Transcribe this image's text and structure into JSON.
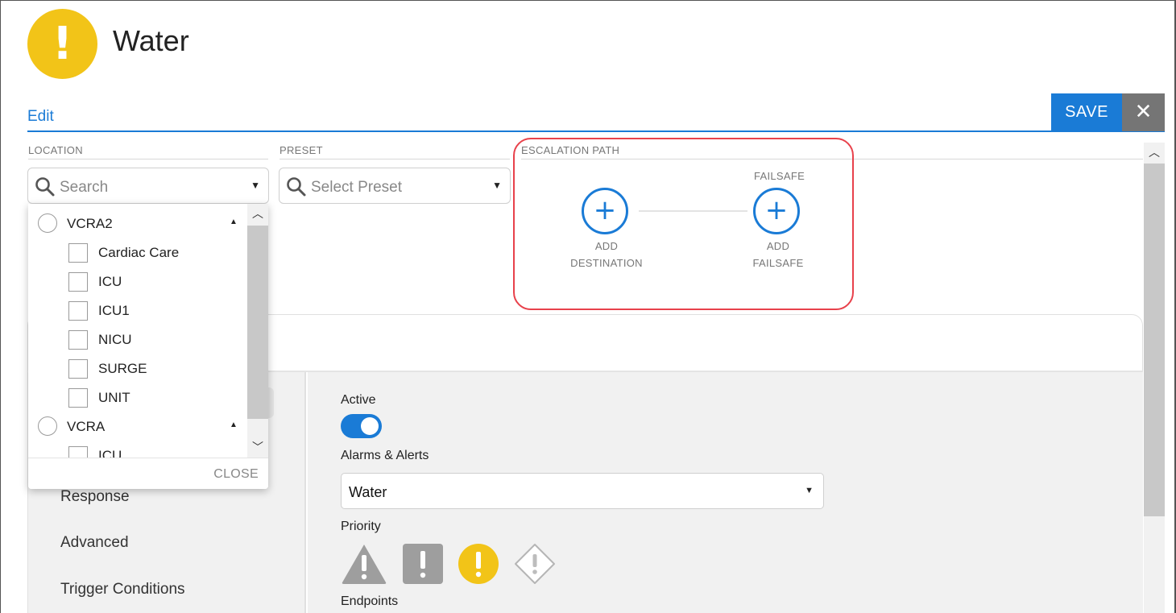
{
  "header": {
    "title": "Water",
    "tab_edit": "Edit",
    "save_label": "SAVE",
    "close_symbol": "✕"
  },
  "location": {
    "label": "LOCATION",
    "placeholder": "Search",
    "groups": [
      {
        "name": "VCRA2",
        "items": [
          "Cardiac Care",
          "ICU",
          "ICU1",
          "NICU",
          "SURGE",
          "UNIT"
        ]
      },
      {
        "name": "VCRA",
        "items": [
          "ICU"
        ]
      }
    ],
    "close_label": "CLOSE"
  },
  "preset": {
    "label": "PRESET",
    "placeholder": "Select Preset"
  },
  "escalation": {
    "label": "ESCALATION PATH",
    "failsafe_header": "FAILSAFE",
    "add_destination_line1": "ADD",
    "add_destination_line2": "DESTINATION",
    "add_failsafe_line1": "ADD",
    "add_failsafe_line2": "FAILSAFE"
  },
  "nav": {
    "items": [
      "Response",
      "Advanced",
      "Trigger Conditions"
    ]
  },
  "form": {
    "active_label": "Active",
    "active_value": true,
    "alarms_label": "Alarms & Alerts",
    "alarms_value": "Water",
    "priority_label": "Priority",
    "priority_options": [
      "critical-triangle-icon",
      "high-square-icon",
      "medium-circle-icon",
      "low-diamond-icon"
    ],
    "priority_selected": "medium-circle-icon",
    "endpoints_label": "Endpoints"
  },
  "colors": {
    "accent": "#1a7bd6",
    "warning_yellow": "#f2c418",
    "highlight_red": "#e8414b",
    "priority_gray": "#9e9e9e"
  }
}
